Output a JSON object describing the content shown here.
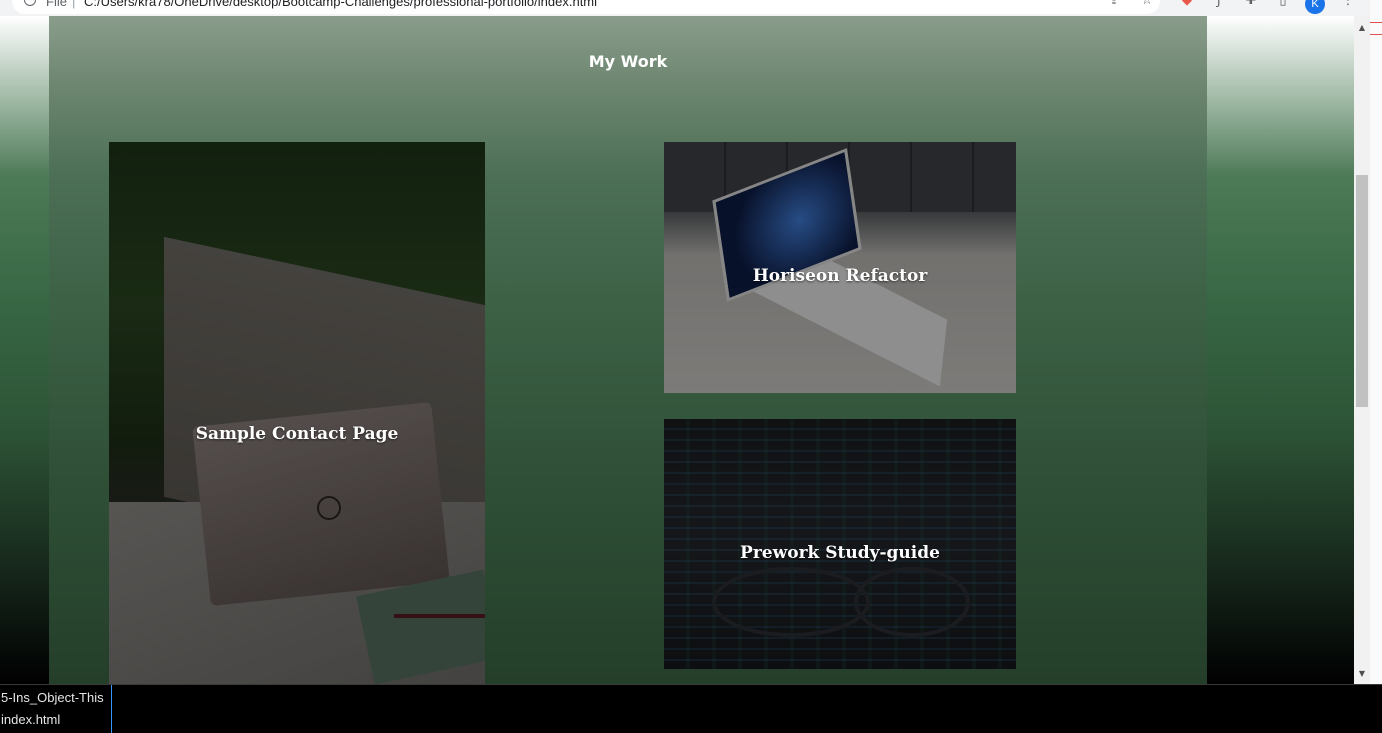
{
  "browser": {
    "scheme": "File",
    "separator": "|",
    "url": "C:/Users/kra78/OneDrive/desktop/Bootcamp-Challenges/professional-portfolio/index.html",
    "avatar_initial": "K",
    "icons": [
      "info-icon",
      "share-icon",
      "star-icon",
      "extension-red-icon",
      "font-extension-icon",
      "puzzle-icon",
      "sidepanel-icon",
      "avatar",
      "menu-icon"
    ]
  },
  "page": {
    "section_title": "My Work",
    "projects": [
      {
        "title": "Sample Contact Page"
      },
      {
        "title": "Horiseon Refactor"
      },
      {
        "title": "Prework Study-guide"
      }
    ]
  },
  "editor_tab": {
    "line1": "5-Ins_Object-This",
    "line2": "index.html"
  },
  "colors": {
    "accent": "#3794ff",
    "container_top": "#8a9d8c",
    "container_bottom": "#243e2a"
  }
}
